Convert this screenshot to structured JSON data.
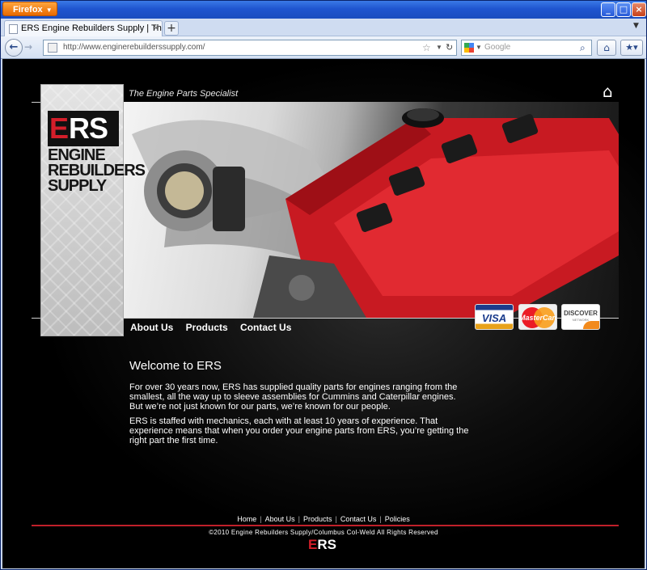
{
  "browser": {
    "app_button": "Firefox",
    "tab_title": "ERS Engine Rebuilders Supply | The Engine P...",
    "url": "http://www.enginerebuilderssupply.com/",
    "search_placeholder": "Google",
    "window_controls": [
      "minimize",
      "maximize",
      "close"
    ]
  },
  "site": {
    "tagline": "The Engine Parts Specialist",
    "logo": {
      "mark_e": "E",
      "mark_rs": "RS",
      "words": [
        "ENGINE",
        "REBUILDERS",
        "SUPPLY"
      ]
    },
    "nav": [
      "About Us",
      "Products",
      "Contact Us"
    ],
    "cards": {
      "visa": "VISA",
      "mastercard": "MasterCard",
      "discover": "DISCOVER",
      "discover_sub": "NETWORK"
    },
    "welcome_title": "Welcome to ERS",
    "paragraphs": [
      "For over 30 years now, ERS has supplied quality parts for engines ranging from the smallest, all the way up to sleeve assemblies for Cummins and Caterpillar engines. But we’re not just known for our parts, we’re known for our people.",
      "ERS is staffed with mechanics, each with at least 10 years of experience. That experience means that when you order your engine parts from ERS, you’re getting the right part the first time."
    ],
    "footer_links": [
      "Home",
      "About Us",
      "Products",
      "Contact Us",
      "Policies"
    ],
    "copyright": "©2010 Engine Rebuilders Supply/Columbus Col-Weld All Rights Reserved",
    "footer_logo_e": "E",
    "footer_logo_rs": "RS"
  }
}
